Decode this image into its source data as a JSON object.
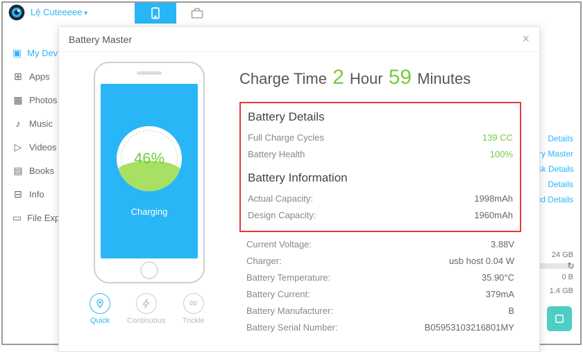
{
  "header": {
    "username": "Lệ Cuteeeee"
  },
  "sidebar": {
    "items": [
      {
        "label": "My Devices",
        "icon": "▣"
      },
      {
        "label": "Apps",
        "icon": "⊞"
      },
      {
        "label": "Photos",
        "icon": "▦"
      },
      {
        "label": "Music",
        "icon": "♪"
      },
      {
        "label": "Videos",
        "icon": "▷"
      },
      {
        "label": "Books",
        "icon": "▤"
      },
      {
        "label": "Info",
        "icon": "⊟"
      },
      {
        "label": "File Explorer",
        "icon": "▭"
      }
    ]
  },
  "rightpeek": {
    "links": [
      "Details",
      "ry Master",
      "isk Details",
      "Details",
      "ud Details"
    ]
  },
  "storage": {
    "total": "24 GB",
    "v1": "0 B",
    "v2": "1.4 GB"
  },
  "modal": {
    "title": "Battery Master",
    "phone": {
      "percent": "46%",
      "status": "Charging"
    },
    "modes": [
      {
        "label": "Quick",
        "glyph": "⎈"
      },
      {
        "label": "Continuous",
        "glyph": "⚡"
      },
      {
        "label": "Trickle",
        "glyph": "∞"
      }
    ],
    "charge": {
      "prefix": "Charge Time",
      "hours": "2",
      "hourWord": "Hour",
      "minutes": "59",
      "minWord": "Minutes"
    },
    "batteryDetails": {
      "title": "Battery Details",
      "rows": [
        {
          "label": "Full Charge Cycles",
          "value": "139",
          "unit": " CC"
        },
        {
          "label": "Battery Health",
          "value": "100%"
        }
      ]
    },
    "batteryInfo": {
      "title": "Battery Information",
      "rows": [
        {
          "label": "Actual Capacity:",
          "value": "1998mAh"
        },
        {
          "label": "Design Capacity:",
          "value": "1960mAh"
        }
      ]
    },
    "extraRows": [
      {
        "label": "Current Voltage:",
        "value": "3.88V"
      },
      {
        "label": "Charger:",
        "value": "usb host 0.04 W"
      },
      {
        "label": "Battery Temperature:",
        "value": "35.90°C"
      },
      {
        "label": "Battery Current:",
        "value": "379mA"
      },
      {
        "label": "Battery Manufacturer:",
        "value": "B"
      },
      {
        "label": "Battery Serial Number:",
        "value": "B05953103216801MY"
      }
    ]
  }
}
